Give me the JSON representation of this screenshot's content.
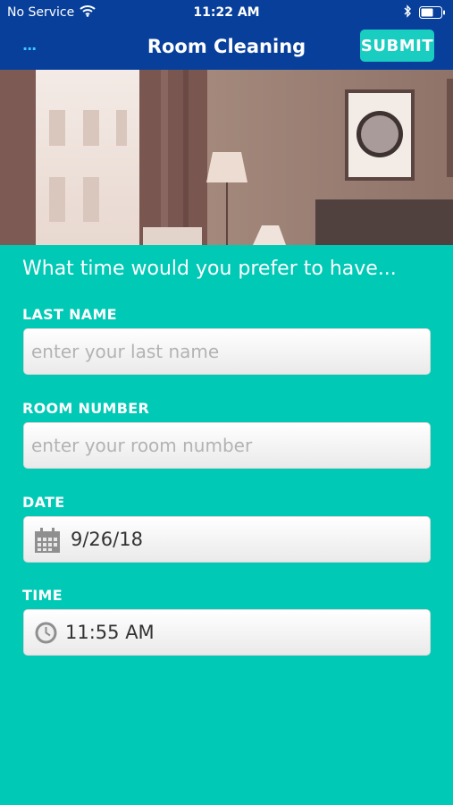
{
  "status_bar": {
    "carrier": "No Service",
    "time": "11:22 AM"
  },
  "nav": {
    "back": "...",
    "title": "Room Cleaning",
    "submit_label": "SUBMIT"
  },
  "form": {
    "prompt": "What time would you prefer to have...",
    "last_name": {
      "label": "LAST NAME",
      "placeholder": "enter your last name"
    },
    "room_number": {
      "label": "ROOM NUMBER",
      "placeholder": "enter your room number"
    },
    "date": {
      "label": "DATE",
      "value": "9/26/18"
    },
    "time": {
      "label": "TIME",
      "value": "11:55 AM"
    }
  },
  "colors": {
    "nav_bg": "#073f9b",
    "page_bg": "#00c9b6",
    "accent": "#19cdc0"
  },
  "icons": [
    "wifi-icon",
    "bluetooth-icon",
    "battery-icon",
    "calendar-icon",
    "clock-icon"
  ]
}
